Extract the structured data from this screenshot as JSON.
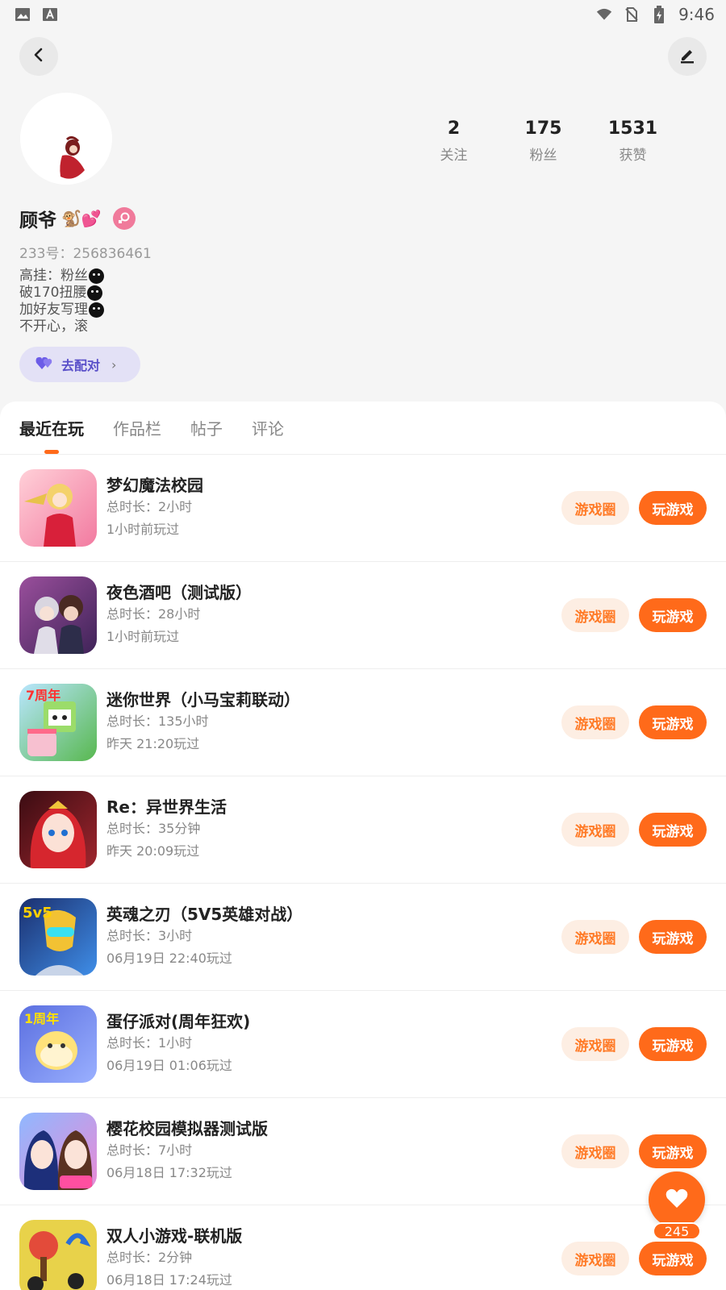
{
  "status_bar": {
    "time": "9:46",
    "icons": [
      "image-icon",
      "text-a-icon",
      "wifi-icon",
      "no-sim-icon",
      "battery-icon"
    ]
  },
  "header": {
    "back_icon": "chevron-left-icon",
    "edit_icon": "edit-pen-icon"
  },
  "profile": {
    "stats": [
      {
        "num": "2",
        "label": "关注"
      },
      {
        "num": "175",
        "label": "粉丝"
      },
      {
        "num": "1531",
        "label": "获赞"
      }
    ],
    "name": "顾爷",
    "name_emojis": "🐒💕",
    "uid": "233号：256836461",
    "bio": [
      "高挂：粉丝",
      "破170扭腰",
      "加好友写理",
      "不开心，滚"
    ],
    "match_label": "去配对"
  },
  "tabs": [
    {
      "label": "最近在玩",
      "active": true
    },
    {
      "label": "作品栏",
      "active": false
    },
    {
      "label": "帖子",
      "active": false
    },
    {
      "label": "评论",
      "active": false
    }
  ],
  "games": [
    {
      "name": "梦幻魔法校园",
      "duration": "总时长：2小时",
      "last": "1小时前玩过",
      "color": "#f7a8b9",
      "icon": "magic-school-game-icon"
    },
    {
      "name": "夜色酒吧（测试版）",
      "duration": "总时长：28小时",
      "last": "1小时前玩过",
      "color": "#6b3c78",
      "icon": "night-bar-game-icon"
    },
    {
      "name": "迷你世界（小马宝莉联动）",
      "duration": "总时长：135小时",
      "last": "昨天 21:20玩过",
      "color": "#7cc466",
      "icon": "mini-world-game-icon"
    },
    {
      "name": "Re：异世界生活",
      "duration": "总时长：35分钟",
      "last": "昨天 20:09玩过",
      "color": "#8a1c24",
      "icon": "re-world-game-icon"
    },
    {
      "name": "英魂之刃（5V5英雄对战）",
      "duration": "总时长：3小时",
      "last": "06月19日 22:40玩过",
      "color": "#2b4ea8",
      "icon": "hero-blade-game-icon"
    },
    {
      "name": "蛋仔派对(周年狂欢)",
      "duration": "总时长：1小时",
      "last": "06月19日 01:06玩过",
      "color": "#6a7fe0",
      "icon": "eggy-party-game-icon"
    },
    {
      "name": "樱花校园模拟器测试版",
      "duration": "总时长：7小时",
      "last": "06月18日 17:32玩过",
      "color": "#3b5fd6",
      "icon": "sakura-school-game-icon"
    },
    {
      "name": "双人小游戏-联机版",
      "duration": "总时长：2分钟",
      "last": "06月18日 17:24玩过",
      "color": "#e8d24a",
      "icon": "two-player-game-icon"
    }
  ],
  "buttons": {
    "circle": "游戏圈",
    "play": "玩游戏"
  },
  "fab": {
    "icon": "heart-icon",
    "count": "245"
  }
}
